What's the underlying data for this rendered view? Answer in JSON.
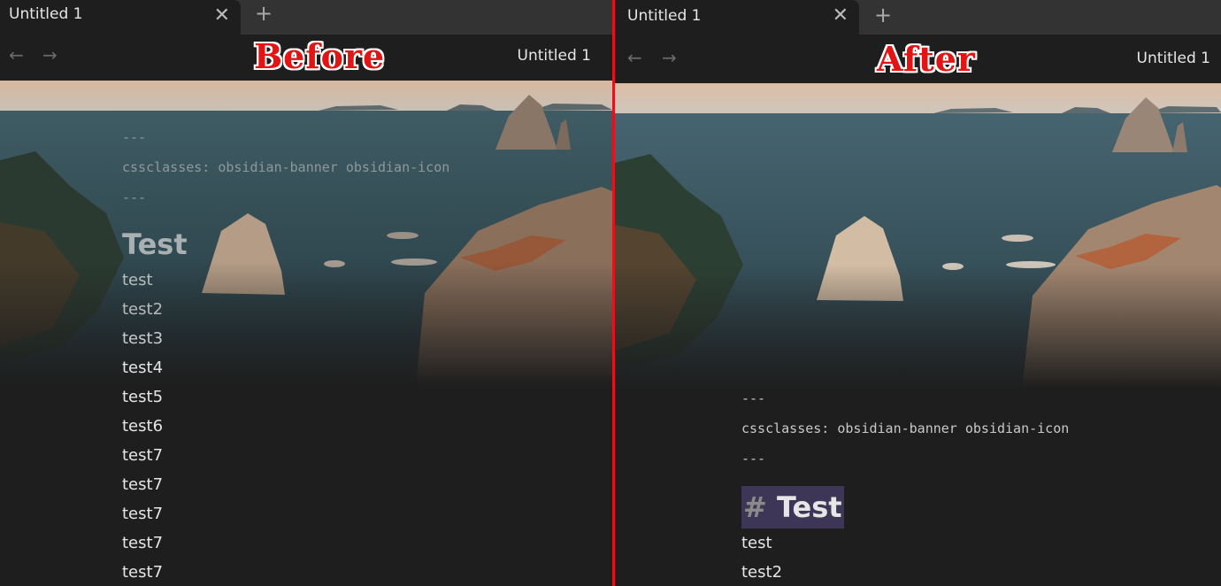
{
  "before": {
    "tab_title": "Untitled 1",
    "tab_close": "✕",
    "tab_new": "+",
    "nav_back": "←",
    "nav_forward": "→",
    "nav_title": "Untitled 1",
    "label": "Before",
    "frontmatter": [
      "---",
      "cssclasses: obsidian-banner obsidian-icon",
      "---"
    ],
    "heading": "Test",
    "lines": [
      "test",
      "test2",
      "test3",
      "test4",
      "test5",
      "test6",
      "test7",
      "test7",
      "test7",
      "test7",
      "test7"
    ]
  },
  "after": {
    "tab_title": "Untitled 1",
    "tab_close": "✕",
    "tab_new": "+",
    "nav_back": "←",
    "nav_forward": "→",
    "nav_title": "Untitled 1",
    "label": "After",
    "frontmatter": [
      "---",
      "cssclasses: obsidian-banner obsidian-icon",
      "---"
    ],
    "heading_hash": "#",
    "heading": "Test",
    "lines": [
      "test",
      "test2"
    ]
  },
  "colors": {
    "divider": "#e0141e",
    "label": "#e21414",
    "background": "#1e1e1e",
    "tabstrip": "#333333",
    "heading_highlight": "#3e3656"
  }
}
